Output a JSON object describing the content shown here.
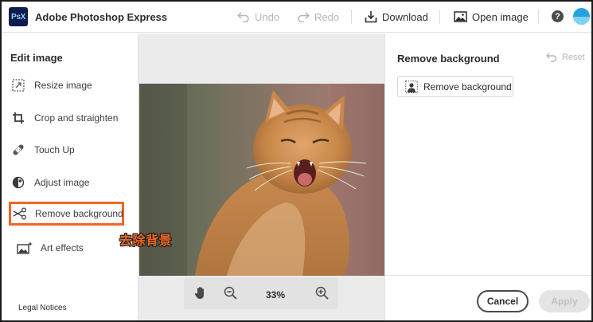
{
  "app": {
    "logo_text": "PsX",
    "title": "Adobe Photoshop Express"
  },
  "toolbar": {
    "undo_label": "Undo",
    "redo_label": "Redo",
    "download_label": "Download",
    "open_image_label": "Open image",
    "help_label": "?"
  },
  "left_panel": {
    "title": "Edit image",
    "items": [
      {
        "label": "Resize image",
        "icon": "resize-icon"
      },
      {
        "label": "Crop and straighten",
        "icon": "crop-icon"
      },
      {
        "label": "Touch Up",
        "icon": "bandage-icon"
      },
      {
        "label": "Adjust image",
        "icon": "adjust-icon"
      },
      {
        "label": "Remove background",
        "icon": "scissors-icon",
        "active": true
      },
      {
        "label": "Art effects",
        "icon": "sparkle-image-icon"
      }
    ],
    "legal_label": "Legal Notices"
  },
  "canvas": {
    "zoom_value": "33%"
  },
  "right_panel": {
    "title": "Remove background",
    "reset_label": "Reset",
    "action_label": "Remove background",
    "cancel_label": "Cancel",
    "apply_label": "Apply"
  },
  "overlay": {
    "caption": "去除背景"
  },
  "colors": {
    "accent": "#f26722",
    "logo_bg": "#0e1b4d",
    "avatar": "#27a2e0"
  }
}
